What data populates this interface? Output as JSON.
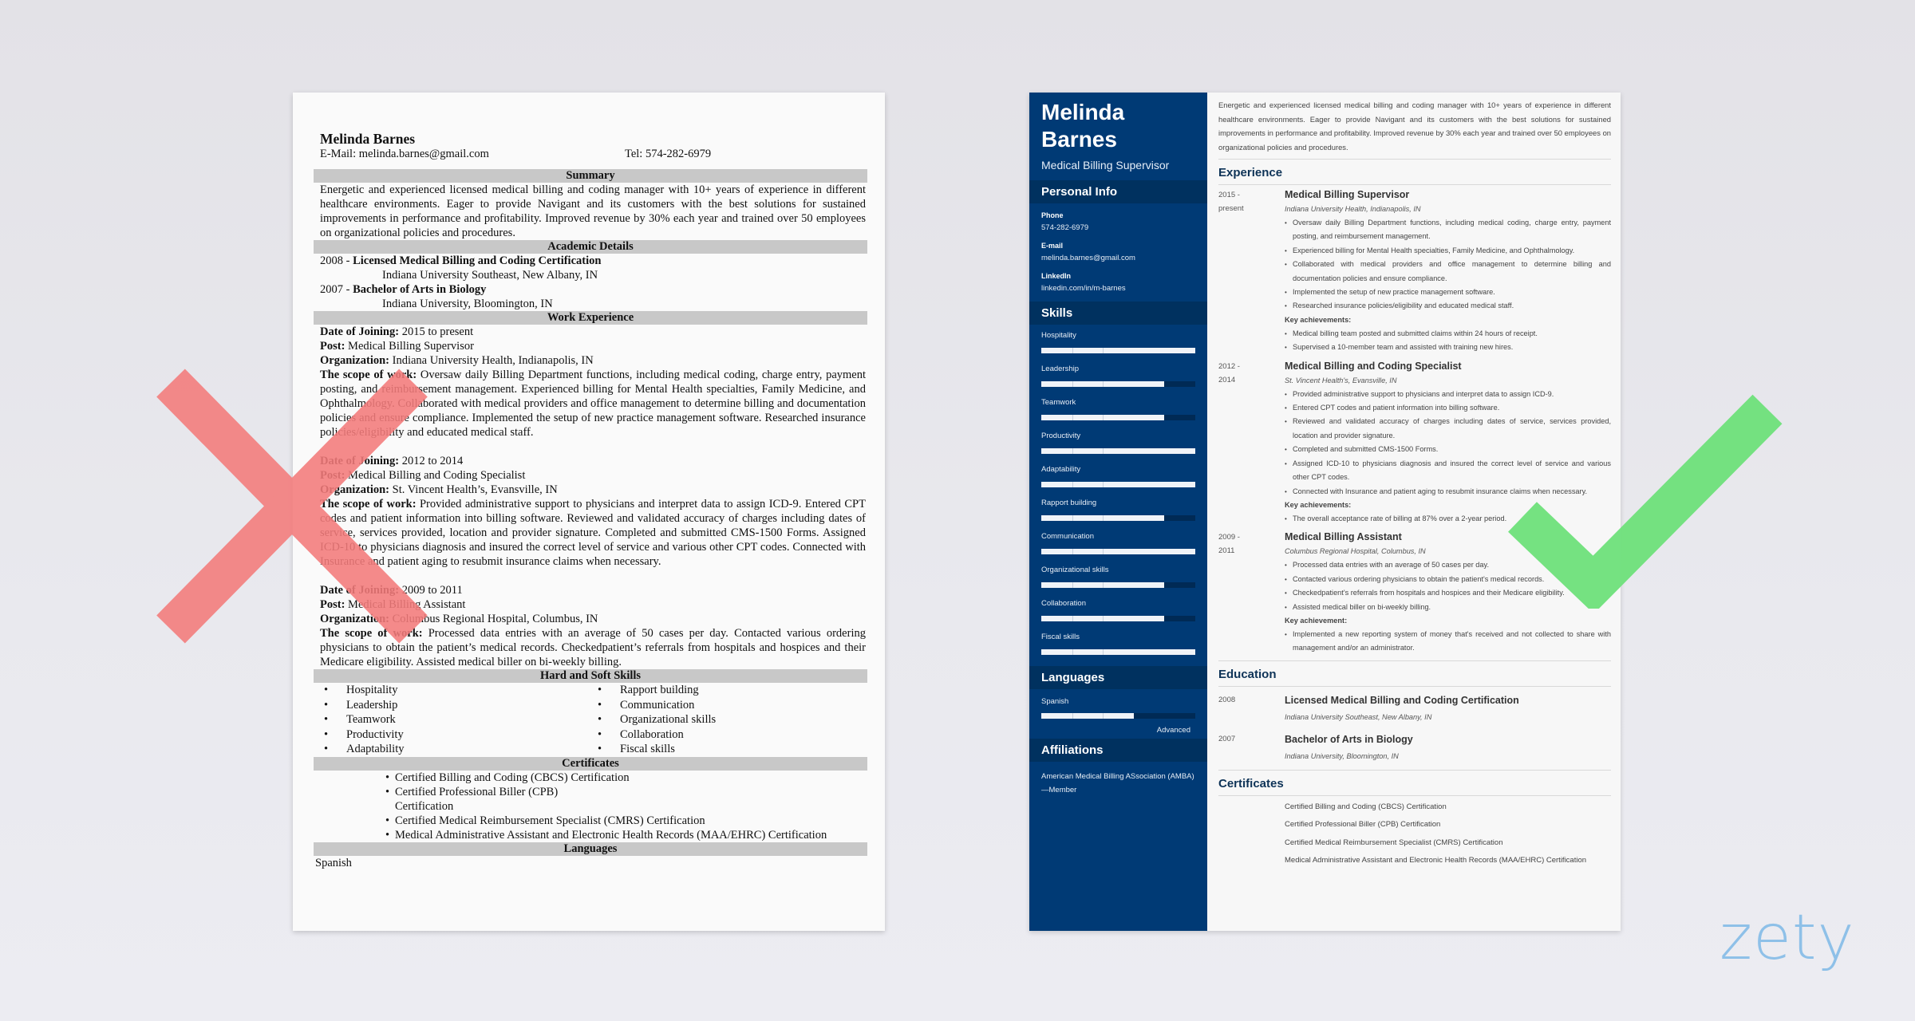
{
  "left_resume": {
    "name": "Melinda Barnes",
    "email": "E-Mail: melinda.barnes@gmail.com",
    "phone": "Tel: 574-282-6979",
    "sections": {
      "summary": "Summary",
      "academic": "Academic Details",
      "work": "Work Experience",
      "skills": "Hard and Soft Skills",
      "certificates": "Certificates",
      "languages": "Languages"
    },
    "summary_text": "Energetic and experienced licensed medical billing and coding manager with 10+ years of experience in different healthcare environments. Eager to provide Navigant and its customers with the best solutions for sustained improvements in performance and profitability. Improved revenue by 30% each year and trained over 50 employees on organizational policies and procedures.",
    "education": [
      {
        "year": "2008 - ",
        "degree": "Licensed Medical Billing and Coding Certification",
        "institution": "Indiana University Southeast, New Albany, IN"
      },
      {
        "year": "2007 - ",
        "degree": "Bachelor of Arts in Biology",
        "institution": "Indiana University, Bloomington, IN"
      }
    ],
    "labels": {
      "date": "Date of Joining:",
      "post": "Post:",
      "org": "Organization:",
      "scope": "The scope of work:"
    },
    "jobs": [
      {
        "date": " 2015 to present",
        "post": " Medical Billing Supervisor",
        "org": " Indiana University Health, Indianapolis, IN",
        "scope": " Oversaw daily Billing Department functions, including medical coding, charge entry, payment posting, and reimbursement management. Experienced billing for Mental Health specialties, Family Medicine, and Ophthalmology. Collaborated with medical providers and office management to determine billing and documentation policies and ensure compliance. Implemented the setup of new practice management software. Researched insurance policies/eligibility and educated medical staff."
      },
      {
        "date": " 2012 to 2014",
        "post": " Medical Billing and Coding Specialist",
        "org": " St. Vincent Health’s, Evansville, IN",
        "scope": " Provided administrative support to physicians and interpret data to assign ICD-9. Entered CPT codes and patient information into billing software. Reviewed and validated accuracy of charges including dates of service, services provided, location and provider signature. Completed and submitted CMS-1500 Forms. Assigned ICD-10 to physicians diagnosis and insured the correct level of service and various other CPT codes. Connected with Insurance and patient aging to resubmit insurance claims when necessary."
      },
      {
        "date": " 2009 to 2011",
        "post": " Medical Billing Assistant",
        "org": " Columbus Regional Hospital, Columbus, IN",
        "scope": " Processed data entries with an average of 50 cases per day. Contacted various ordering physicians to obtain the patient’s medical records. Checkedpatient’s referrals from hospitals and hospices and their Medicare eligibility. Assisted medical biller on bi-weekly billing."
      }
    ],
    "skills_col1": [
      "Hospitality",
      "Leadership",
      "Teamwork",
      "Productivity",
      "Adaptability"
    ],
    "skills_col2": [
      "Rapport building",
      "Communication",
      "Organizational skills",
      "Collaboration",
      "Fiscal skills"
    ],
    "certificates": [
      "Certified Billing and Coding (CBCS) Certification",
      "Certified Professional Biller (CPB)\nCertification",
      "Certified Medical Reimbursement Specialist (CMRS) Certification",
      "Medical Administrative Assistant and Electronic Health Records (MAA/EHRC) Certification"
    ],
    "language": "Spanish"
  },
  "right_resume": {
    "name_first": "Melinda",
    "name_last": "Barnes",
    "title": "Medical Billing Supervisor",
    "colors": {
      "sidebar": "#003a75",
      "sidebar_header": "#00315f",
      "heading": "#0e3357"
    },
    "sidebar": {
      "personal_info_heading": "Personal Info",
      "info": [
        {
          "label": "Phone",
          "value": "574-282-6979"
        },
        {
          "label": "E-mail",
          "value": "melinda.barnes@gmail.com"
        },
        {
          "label": "LinkedIn",
          "value": "linkedin.com/in/m-barnes"
        }
      ],
      "skills_heading": "Skills",
      "skills": [
        {
          "name": "Hospitality",
          "level": 1.0
        },
        {
          "name": "Leadership",
          "level": 0.8
        },
        {
          "name": "Teamwork",
          "level": 0.8
        },
        {
          "name": "Productivity",
          "level": 1.0
        },
        {
          "name": "Adaptability",
          "level": 1.0
        },
        {
          "name": "Rapport building",
          "level": 0.8
        },
        {
          "name": "Communication",
          "level": 1.0
        },
        {
          "name": "Organizational skills",
          "level": 0.8
        },
        {
          "name": "Collaboration",
          "level": 0.8
        },
        {
          "name": "Fiscal skills",
          "level": 1.0
        }
      ],
      "languages_heading": "Languages",
      "languages": [
        {
          "name": "Spanish",
          "level": 0.6,
          "level_label": "Advanced"
        }
      ],
      "affiliations_heading": "Affiliations",
      "affiliations": "American Medical Billing ASsociation (AMBA)—Member"
    },
    "summary": "Energetic and experienced licensed medical billing and coding manager with 10+ years of experience in different healthcare environments. Eager to provide Navigant and its customers with the best solutions for sustained improvements in performance and profitability. Improved revenue by 30% each year and trained over 50 employees on organizational policies and procedures.",
    "experience_heading": "Experience",
    "jobs": [
      {
        "date": "2015 - present",
        "title": "Medical Billing Supervisor",
        "org": "Indiana University Health, Indianapolis, IN",
        "bullets": [
          "Oversaw daily Billing Department functions, including medical coding, charge entry, payment posting, and reimbursement management.",
          "Experienced billing for Mental Health specialties, Family Medicine, and Ophthalmology.",
          "Collaborated with medical providers and office management to determine billing and documentation policies and ensure compliance.",
          "Implemented the setup of new practice management software.",
          "Researched insurance policies/eligibility and educated medical staff."
        ],
        "achievements_label": "Key achievements:",
        "achievements": [
          "Medical billing team posted and submitted claims within 24 hours of receipt.",
          "Supervised a 10-member team and assisted with training new hires."
        ]
      },
      {
        "date": "2012 - 2014",
        "title": "Medical Billing and Coding Specialist",
        "org": "St. Vincent Health's, Evansville, IN",
        "bullets": [
          "Provided administrative support to physicians and interpret data to assign ICD-9.",
          "Entered CPT codes and patient information into billing software.",
          "Reviewed and validated accuracy of charges including dates of service, services provided, location and provider signature.",
          "Completed and submitted CMS-1500 Forms.",
          "Assigned ICD-10 to physicians diagnosis and insured the correct level of service and various other CPT codes.",
          "Connected with Insurance and patient aging to resubmit insurance claims when necessary."
        ],
        "achievements_label": "Key achievements:",
        "achievements": [
          "The overall acceptance rate of billing at 87% over a 2-year period."
        ]
      },
      {
        "date": "2009 - 2011",
        "title": "Medical Billing Assistant",
        "org": "Columbus Regional Hospital, Columbus, IN",
        "bullets": [
          "Processed data entries with an average of 50 cases per day.",
          "Contacted various ordering physicians to obtain the patient's medical records.",
          "Checkedpatient's referrals from hospitals and hospices and their Medicare eligibility.",
          "Assisted medical biller on bi-weekly billing."
        ],
        "achievements_label": "Key achievement:",
        "achievements": [
          "Implemented a new reporting system of money that's received and not collected to share with management and/or an administrator."
        ]
      }
    ],
    "education_heading": "Education",
    "education": [
      {
        "year": "2008",
        "degree": "Licensed Medical Billing and Coding Certification",
        "institution": "Indiana University Southeast, New Albany, IN"
      },
      {
        "year": "2007",
        "degree": "Bachelor of Arts in Biology",
        "institution": "Indiana University, Bloomington, IN"
      }
    ],
    "certificates_heading": "Certificates",
    "certificates": [
      "Certified Billing and Coding (CBCS) Certification",
      "Certified Professional Biller (CPB) Certification",
      "Certified Medical Reimbursement Specialist (CMRS) Certification",
      "Medical Administrative Assistant and Electronic Health Records (MAA/EHRC) Certification"
    ]
  },
  "marks": {
    "bad_icon": "x-mark-icon",
    "good_icon": "check-mark-icon",
    "bad_color": "#f47b7b",
    "good_color": "#6ee07a"
  },
  "brand": {
    "logo": "zety",
    "color": "#8ec0e8"
  }
}
